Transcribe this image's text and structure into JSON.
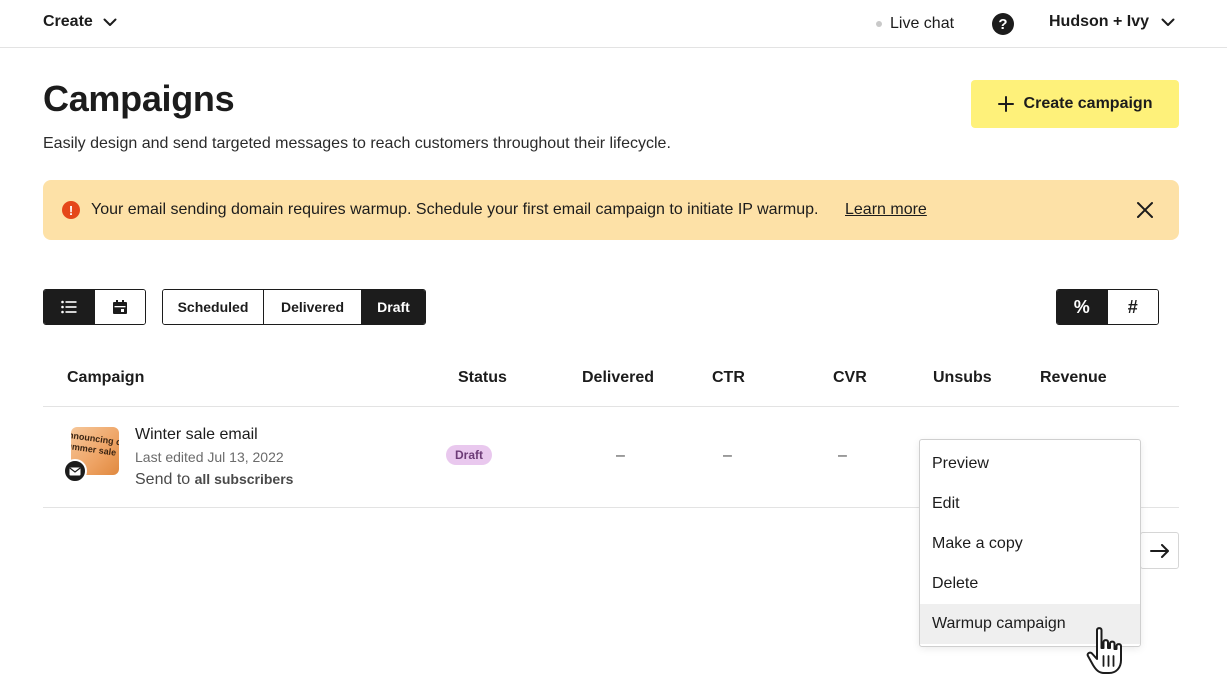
{
  "topbar": {
    "create_label": "Create",
    "live_chat_label": "Live chat",
    "help_glyph": "?",
    "account_name": "Hudson + Ivy"
  },
  "header": {
    "title": "Campaigns",
    "subtitle": "Easily design and send targeted messages to reach customers throughout their lifecycle.",
    "create_button_label": "Create campaign"
  },
  "alert": {
    "icon_glyph": "!",
    "message": "Your email sending domain requires warmup. Schedule your first email campaign to initiate IP warmup.",
    "link_label": "Learn more"
  },
  "toolbar": {
    "view_options": [
      {
        "icon": "list-icon",
        "active": true
      },
      {
        "icon": "calendar-icon",
        "active": false
      }
    ],
    "filters": [
      {
        "label": "Scheduled",
        "active": false
      },
      {
        "label": "Delivered",
        "active": false
      },
      {
        "label": "Draft",
        "active": true
      }
    ],
    "metric_options": [
      {
        "label": "%",
        "active": true
      },
      {
        "label": "#",
        "active": false
      }
    ]
  },
  "table": {
    "columns": [
      "Campaign",
      "Status",
      "Delivered",
      "CTR",
      "CVR",
      "Unsubs",
      "Revenue"
    ],
    "rows": [
      {
        "thumbnail_text": "nnouncing o\nummer sale",
        "name": "Winter sale email",
        "edited": "Last edited Jul 13, 2022",
        "send_prefix": "Send to",
        "send_target": "all subscribers",
        "status": "Draft",
        "delivered": "–",
        "ctr": "–",
        "cvr": "–"
      }
    ]
  },
  "context_menu": {
    "items": [
      {
        "label": "Preview",
        "hover": false
      },
      {
        "label": "Edit",
        "hover": false
      },
      {
        "label": "Make a copy",
        "hover": false
      },
      {
        "label": "Delete",
        "hover": false
      },
      {
        "label": "Warmup campaign",
        "hover": true
      }
    ]
  },
  "colors": {
    "primary_button": "#fef17a",
    "alert_bg": "#fde1a7",
    "alert_icon": "#e5471a",
    "draft_badge_bg": "#e9c8ee",
    "dark": "#1c1c1c"
  }
}
